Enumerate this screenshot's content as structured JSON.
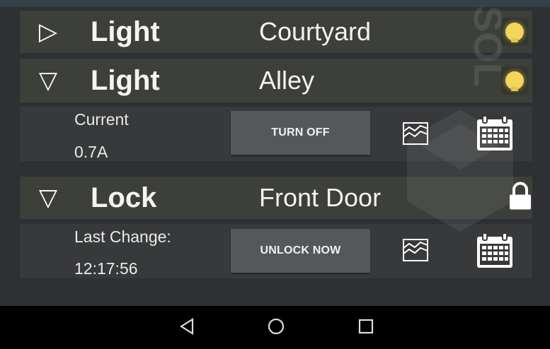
{
  "devices": [
    {
      "toggle_icon": "▷",
      "type": "Light",
      "name": "Courtyard",
      "status_icon": "bulb-icon",
      "expanded": false
    },
    {
      "toggle_icon": "▽",
      "type": "Light",
      "name": "Alley",
      "status_icon": "bulb-icon",
      "expanded": true,
      "detail": {
        "label_line1": "Current",
        "label_line2": "0.7A",
        "action": "TURN OFF"
      }
    },
    {
      "toggle_icon": "▽",
      "type": "Lock",
      "name": "Front Door",
      "status_icon": "lock-icon",
      "expanded": true,
      "detail": {
        "label_line1": "Last Change:",
        "label_line2": "12:17:56",
        "action": "UNLOCK NOW"
      }
    }
  ],
  "watermark_text": "SOL",
  "nav": {
    "back": "◁",
    "home": "○",
    "recents": "□"
  },
  "colors": {
    "bulb": "#f2d55a",
    "row_bg": "#3d3f3a",
    "panel_bg": "#37393b",
    "button_bg": "#55585a"
  }
}
